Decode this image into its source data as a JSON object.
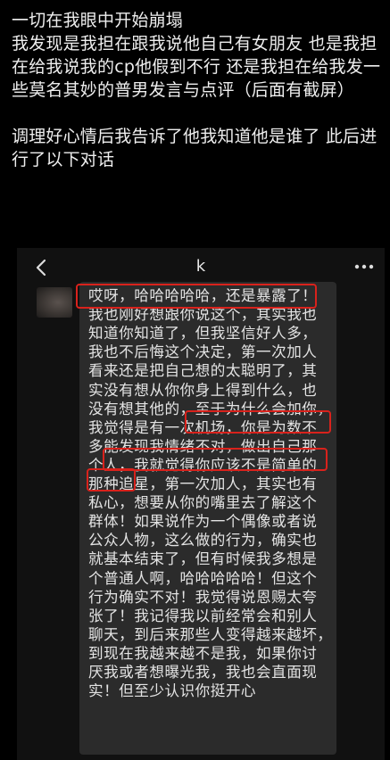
{
  "post": {
    "lines": [
      "一切在我眼中开始崩塌",
      "我发现是我担在跟我说他自己有女朋友 也是我担在给我说我的cp他假到不行 还是我担在给我发一些莫名其妙的普男发言与点评（后面有截屏）",
      "调理好心情后我告诉了他我知道他是谁了 此后进行了以下对话"
    ]
  },
  "chat": {
    "title": "k",
    "back_icon": "chevron-left-icon",
    "more_icon": "more-dots-icon",
    "message_lines": [
      "哎呀，哈哈哈哈哈，还是暴露了！",
      "我也刚好想跟你说这个，其实我也",
      "知道你知道了，但我坚信好人多，",
      "我也不后悔这个决定，第一次加人",
      "看来还是把自己想的太聪明了，其",
      "实没有想从你你身上得到什么，也",
      "没有想其他的，至于为什么会加你，",
      "我觉得是有一次机场，你是为数不",
      "多能发现我情绪不对，做出自己那",
      "个人，我就觉得你应该不是简单的",
      "那种追星，第一次加人，其实也有",
      "私心，想要从你的嘴里去了解这个",
      "群体！如果说作为一个偶像或者说",
      "公众人物，这么做的行为，确实也",
      "就基本结束了，但有时候我多想是",
      "个普通人啊，哈哈哈哈哈！但这个",
      "行为确实不对！我觉得说恩赐太夸",
      "张了！我记得我以前经常会和别人",
      "聊天，到后来那些人变得越来越坏，",
      "到现在我越来越不是我，如果你讨",
      "厌我或者想曝光我，我也会直面现",
      "实！但至少认识你挺开心"
    ]
  },
  "colors": {
    "background": "#000000",
    "bubble": "#2b2b2b",
    "highlight": "#d9221c",
    "text": "#e4e4e4"
  }
}
